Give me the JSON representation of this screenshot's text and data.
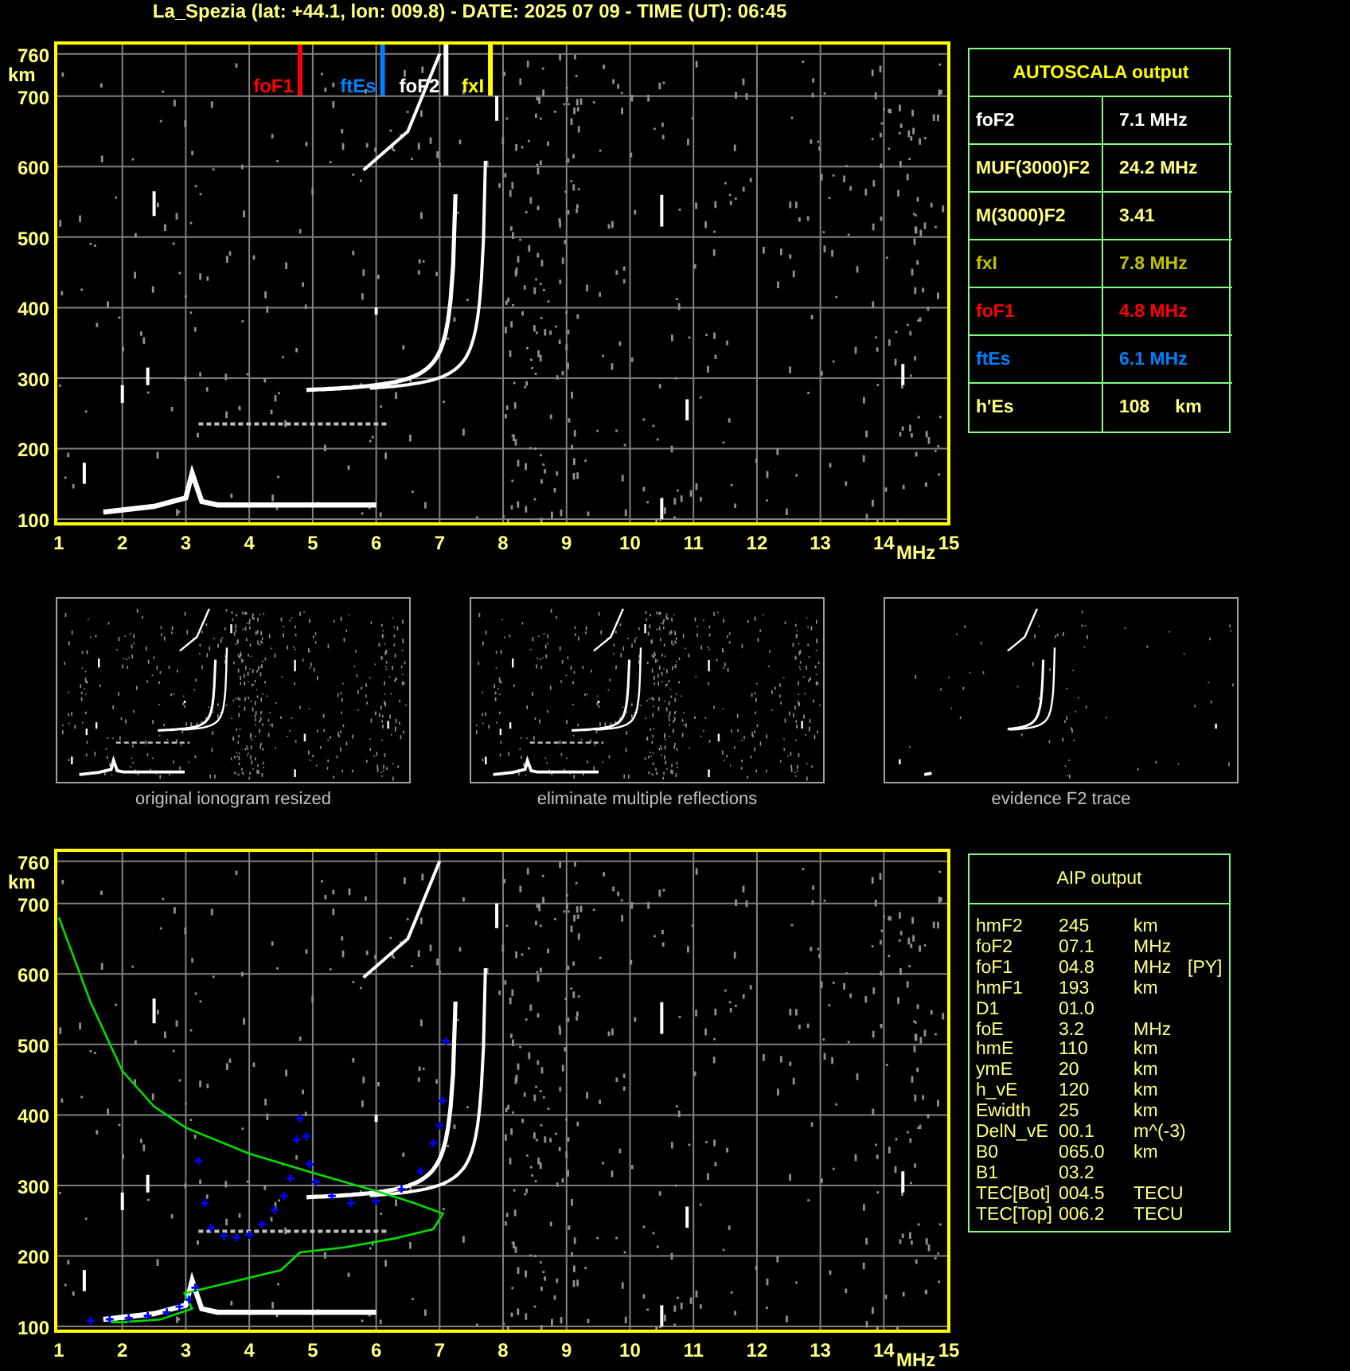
{
  "title": "La_Spezia (lat: +44.1, lon: 009.8) - DATE: 2025 07 09 - TIME (UT): 06:45",
  "ionogram": {
    "y_unit": "km",
    "y_ticks": [
      "760",
      "700",
      "600",
      "500",
      "400",
      "300",
      "200",
      "100"
    ],
    "x_ticks": [
      "1",
      "2",
      "3",
      "4",
      "5",
      "6",
      "7",
      "8",
      "9",
      "10",
      "11",
      "12",
      "13",
      "14"
    ],
    "x_unit": "MHz",
    "x_end": "15",
    "markers": [
      {
        "label": "foF1",
        "color": "#ff0000"
      },
      {
        "label": "ftEs",
        "color": "#0080ff"
      },
      {
        "label": "foF2",
        "color": "#ffffff"
      },
      {
        "label": "fxI",
        "color": "#ffff00"
      }
    ]
  },
  "autoscala": {
    "title": "AUTOSCALA output",
    "rows": [
      {
        "name": "foF2",
        "value": "7.1",
        "unit": "MHz",
        "color": "#ffffff"
      },
      {
        "name": "MUF(3000)F2",
        "value": "24.2",
        "unit": "MHz",
        "color": "#ffff80"
      },
      {
        "name": "M(3000)F2",
        "value": "3.41",
        "color": "#ffff80"
      },
      {
        "name": "fxI",
        "value": "7.8",
        "unit": "MHz",
        "color": "#c0c000"
      },
      {
        "name": "foF1",
        "value": "4.8",
        "unit": "MHz",
        "color": "#ff0000"
      },
      {
        "name": "ftEs",
        "value": "6.1",
        "unit": "MHz",
        "color": "#0080ff"
      },
      {
        "name": "h'Es",
        "value": "108",
        "unit": "km",
        "color": "#ffff80"
      }
    ]
  },
  "thumbnails": [
    {
      "caption": "original ionogram resized"
    },
    {
      "caption": "eliminate multiple reflections"
    },
    {
      "caption": "evidence F2 trace"
    }
  ],
  "aip_ionogram": {
    "y_unit": "km",
    "y_ticks": [
      "760",
      "700",
      "600",
      "500",
      "400",
      "300",
      "200",
      "100"
    ],
    "x_ticks": [
      "1",
      "2",
      "3",
      "4",
      "5",
      "6",
      "7",
      "8",
      "9",
      "10",
      "11",
      "12",
      "13",
      "14"
    ],
    "x_unit": "MHz",
    "x_end": "15"
  },
  "aip": {
    "title": "AIP output",
    "rows": [
      {
        "name": "hmF2",
        "value": "245",
        "unit": "km"
      },
      {
        "name": "foF2",
        "value": "07.1",
        "unit": "MHz"
      },
      {
        "name": "foF1",
        "value": "04.8",
        "unit": "MHz",
        "note": "[PY]"
      },
      {
        "name": "hmF1",
        "value": "193",
        "unit": "km"
      },
      {
        "name": "D1",
        "value": "01.0"
      },
      {
        "name": "foE",
        "value": "3.2",
        "unit": "MHz"
      },
      {
        "name": "hmE",
        "value": "110",
        "unit": "km"
      },
      {
        "name": "ymE",
        "value": "20",
        "unit": "km"
      },
      {
        "name": "h_vE",
        "value": "120",
        "unit": "km"
      },
      {
        "name": "Ewidth",
        "value": "25",
        "unit": "km"
      },
      {
        "name": "DelN_vE",
        "value": "00.1",
        "unit": "m^(-3)"
      },
      {
        "name": "B0",
        "value": "065.0",
        "unit": "km"
      },
      {
        "name": "B1",
        "value": "03.2"
      },
      {
        "name": "TEC[Bot]",
        "value": "004.5",
        "unit": "TECU"
      },
      {
        "name": "TEC[Top]",
        "value": "006.2",
        "unit": "TECU"
      }
    ]
  }
}
